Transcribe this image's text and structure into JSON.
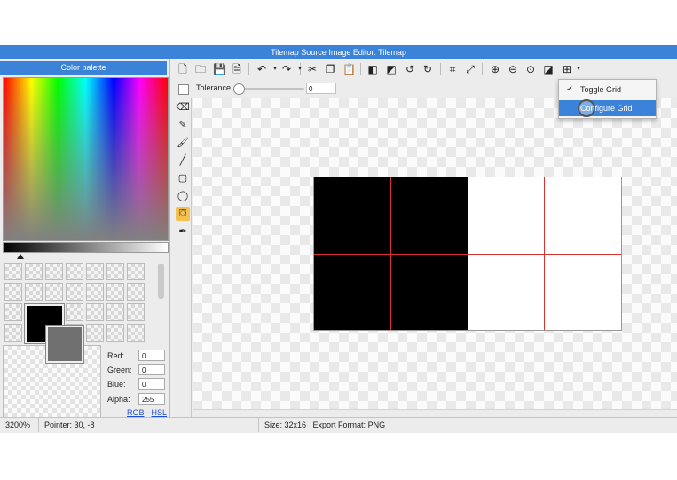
{
  "window": {
    "title": "Tilemap Source Image Editor: Tilemap"
  },
  "palette": {
    "header": "Color palette",
    "fields": [
      {
        "label": "Red:",
        "value": "0"
      },
      {
        "label": "Green:",
        "value": "0"
      },
      {
        "label": "Blue:",
        "value": "0"
      },
      {
        "label": "Alpha:",
        "value": "255"
      }
    ],
    "mode_rgb": "RGB",
    "mode_sep": " - ",
    "mode_hsl": "HSL",
    "foreground_color": "#000000",
    "background_color": "#707070"
  },
  "toolbar": {
    "icons": [
      "new-file-icon",
      "open-folder-icon",
      "save-icon",
      "save-as-icon",
      "undo-icon",
      "redo-icon",
      "cut-icon",
      "copy-icon",
      "paste-icon",
      "flip-horizontal-icon",
      "flip-vertical-icon",
      "rotate-left-icon",
      "rotate-right-icon",
      "crop-icon",
      "resize-icon",
      "zoom-in-icon",
      "zoom-out-icon",
      "zoom-reset-icon",
      "fit-icon",
      "grid-icon"
    ]
  },
  "options": {
    "tolerance_label": "Tolerance",
    "tolerance_value": "0",
    "tolerance_fraction": 0.0
  },
  "tools": [
    "eraser-icon",
    "pen-icon",
    "brush-icon",
    "line-icon",
    "rectangle-icon",
    "ellipse-icon",
    "fill-bucket-icon",
    "eyedropper-icon"
  ],
  "active_tool": "fill-bucket-icon",
  "grid_menu": {
    "items": [
      {
        "label": "Toggle Grid",
        "checked": true
      },
      {
        "label": "Configure Grid",
        "highlighted": true
      }
    ]
  },
  "status": {
    "zoom": "3200%",
    "pointer": "Pointer: 30, -8",
    "size": "Size: 32x16",
    "export_format": "Export Format: PNG"
  },
  "colors": {
    "accent": "#3b82d9",
    "grid_line": "#d9332b",
    "active_tool_bg": "#f5c04f"
  }
}
